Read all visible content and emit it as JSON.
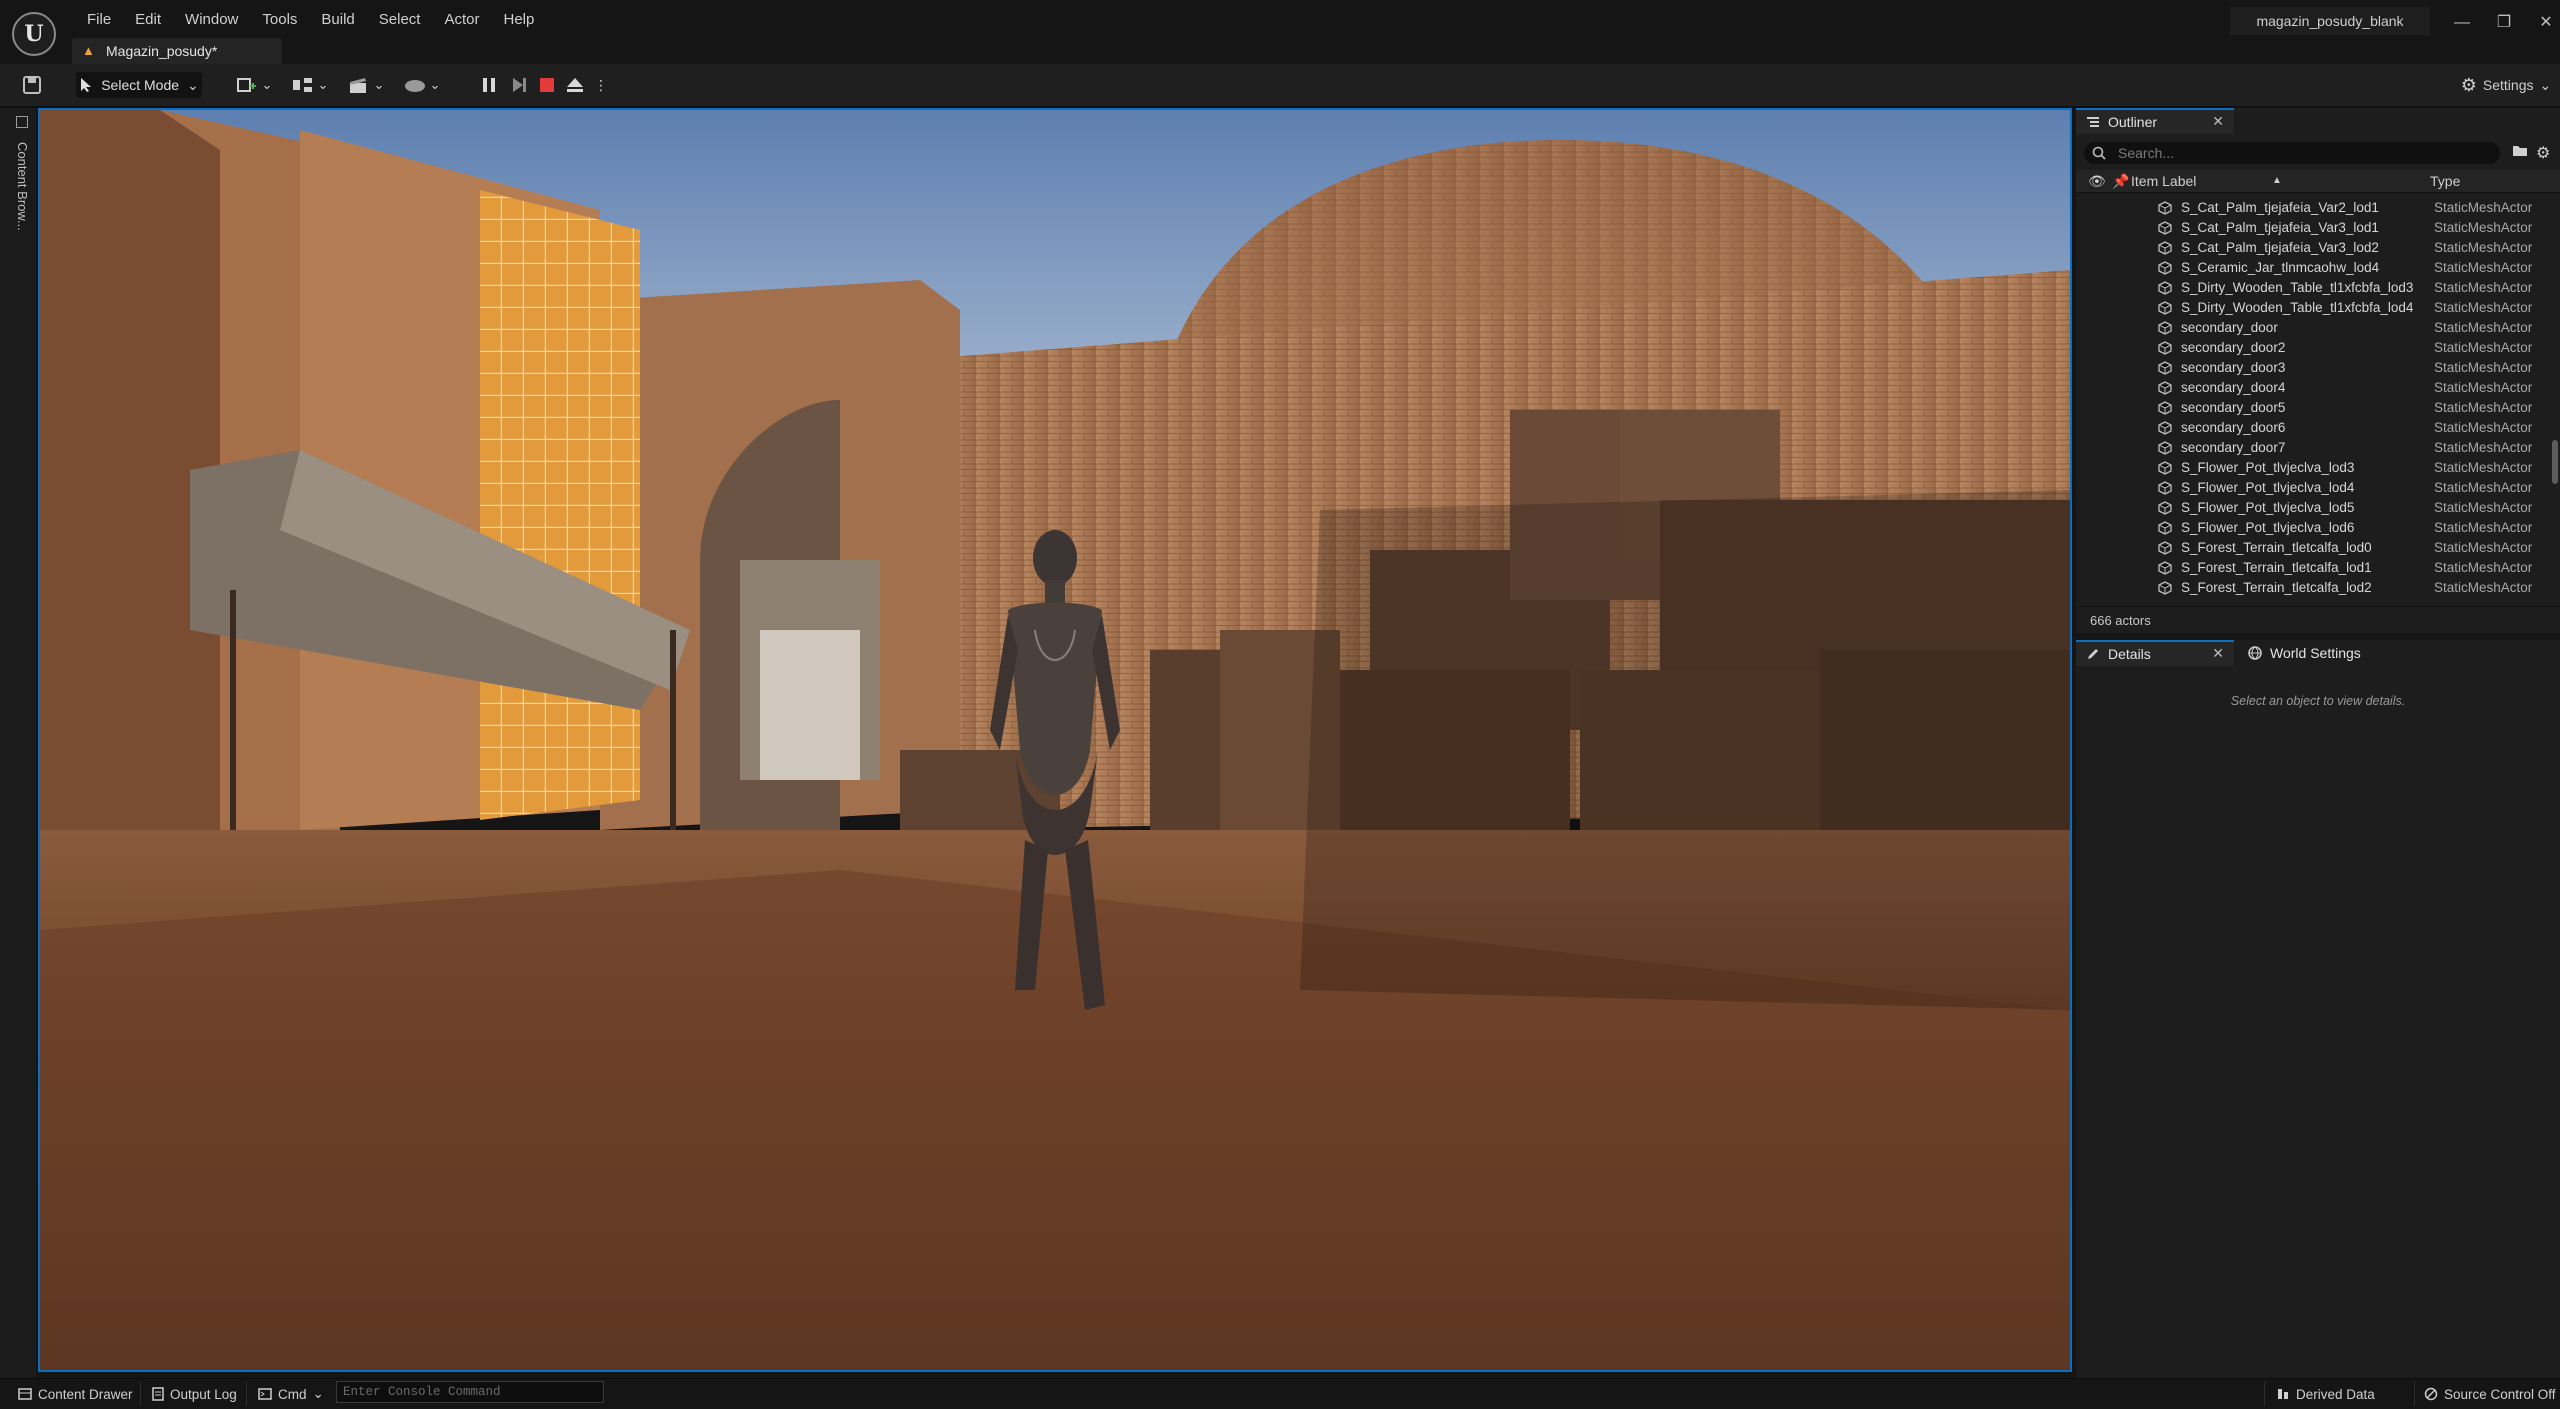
{
  "menu": [
    "File",
    "Edit",
    "Window",
    "Tools",
    "Build",
    "Select",
    "Actor",
    "Help"
  ],
  "project_title": "magazin_posudy_blank",
  "level_tab": {
    "label": "Magazin_posudy*"
  },
  "toolbar": {
    "select_mode": "Select Mode",
    "settings": "Settings"
  },
  "left_drawer": {
    "content_browser": "Content Brow..."
  },
  "outliner": {
    "tab_label": "Outliner",
    "search_placeholder": "Search...",
    "col_label": "Item Label",
    "col_type": "Type",
    "rows": [
      {
        "label": "S_Cat_Palm_tjejafeia_Var2_lod1",
        "type": "StaticMeshActor"
      },
      {
        "label": "S_Cat_Palm_tjejafeia_Var3_lod1",
        "type": "StaticMeshActor"
      },
      {
        "label": "S_Cat_Palm_tjejafeia_Var3_lod2",
        "type": "StaticMeshActor"
      },
      {
        "label": "S_Ceramic_Jar_tlnmcaohw_lod4",
        "type": "StaticMeshActor"
      },
      {
        "label": "S_Dirty_Wooden_Table_tl1xfcbfa_lod3",
        "type": "StaticMeshActor"
      },
      {
        "label": "S_Dirty_Wooden_Table_tl1xfcbfa_lod4",
        "type": "StaticMeshActor"
      },
      {
        "label": "secondary_door",
        "type": "StaticMeshActor"
      },
      {
        "label": "secondary_door2",
        "type": "StaticMeshActor"
      },
      {
        "label": "secondary_door3",
        "type": "StaticMeshActor"
      },
      {
        "label": "secondary_door4",
        "type": "StaticMeshActor"
      },
      {
        "label": "secondary_door5",
        "type": "StaticMeshActor"
      },
      {
        "label": "secondary_door6",
        "type": "StaticMeshActor"
      },
      {
        "label": "secondary_door7",
        "type": "StaticMeshActor"
      },
      {
        "label": "S_Flower_Pot_tlvjeclva_lod3",
        "type": "StaticMeshActor"
      },
      {
        "label": "S_Flower_Pot_tlvjeclva_lod4",
        "type": "StaticMeshActor"
      },
      {
        "label": "S_Flower_Pot_tlvjeclva_lod5",
        "type": "StaticMeshActor"
      },
      {
        "label": "S_Flower_Pot_tlvjeclva_lod6",
        "type": "StaticMeshActor"
      },
      {
        "label": "S_Forest_Terrain_tletcalfa_lod0",
        "type": "StaticMeshActor"
      },
      {
        "label": "S_Forest_Terrain_tletcalfa_lod1",
        "type": "StaticMeshActor"
      },
      {
        "label": "S_Forest_Terrain_tletcalfa_lod2",
        "type": "StaticMeshActor"
      }
    ],
    "actor_count": "666 actors"
  },
  "details": {
    "tab_label": "Details",
    "world_settings_label": "World Settings",
    "empty_message": "Select an object to view details."
  },
  "statusbar": {
    "content_drawer": "Content Drawer",
    "output_log": "Output Log",
    "cmd": "Cmd",
    "console_placeholder": "Enter Console Command",
    "derived_data": "Derived Data",
    "source_control": "Source Control Off"
  },
  "colors": {
    "accent": "#0a6ec2",
    "stop": "#e33b3b",
    "warning": "#e8a33c"
  }
}
